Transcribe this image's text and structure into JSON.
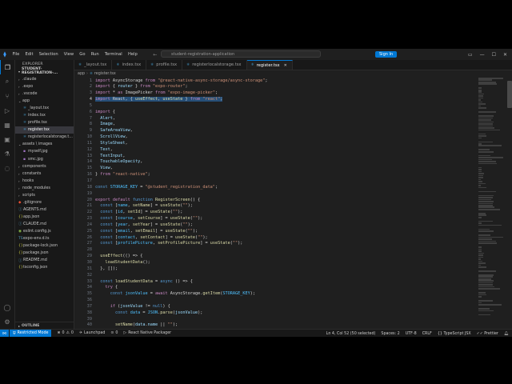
{
  "titlebar": {
    "menu": [
      "File",
      "Edit",
      "Selection",
      "View",
      "Go",
      "Run",
      "Terminal",
      "Help"
    ],
    "back_icon": "arrow-left-icon",
    "forward_icon": "arrow-right-icon",
    "command_center": "student-registration-application",
    "sign_in": "Sign In"
  },
  "activity_bar": {
    "top": [
      "files-icon",
      "search-icon",
      "source-control-icon",
      "run-debug-icon",
      "extensions-icon",
      "remote-explorer-icon",
      "testing-icon",
      "chat-icon"
    ],
    "bottom": [
      "account-icon",
      "settings-gear-icon"
    ]
  },
  "sidebar": {
    "title": "EXPLORER",
    "project": "STUDENT-REGISTRATION-...",
    "outline": "OUTLINE",
    "tree": [
      {
        "label": ".claude",
        "depth": 0,
        "kind": "folder",
        "color": "#c5c5c5"
      },
      {
        "label": ".expo",
        "depth": 0,
        "kind": "folder",
        "color": "#c5c5c5"
      },
      {
        "label": ".vscode",
        "depth": 0,
        "kind": "folder",
        "color": "#c5c5c5"
      },
      {
        "label": "app",
        "depth": 0,
        "kind": "folder-open",
        "color": "#c5c5c5"
      },
      {
        "label": "_layout.tsx",
        "depth": 1,
        "kind": "tsx",
        "color": "#c5c5c5"
      },
      {
        "label": "index.tsx",
        "depth": 1,
        "kind": "tsx",
        "color": "#c5c5c5"
      },
      {
        "label": "profile.tsx",
        "depth": 1,
        "kind": "tsx",
        "color": "#c5c5c5"
      },
      {
        "label": "register.tsx",
        "depth": 1,
        "kind": "tsx",
        "color": "#ffffff",
        "selected": true
      },
      {
        "label": "registerlocalstorage.t...",
        "depth": 1,
        "kind": "tsx",
        "color": "#c5c5c5"
      },
      {
        "label": "assets \\ images",
        "depth": 0,
        "kind": "folder-open",
        "color": "#c5c5c5"
      },
      {
        "label": "myself.jpg",
        "depth": 1,
        "kind": "img",
        "color": "#c5c5c5"
      },
      {
        "label": "smc.jpg",
        "depth": 1,
        "kind": "img",
        "color": "#c5c5c5"
      },
      {
        "label": "components",
        "depth": 0,
        "kind": "folder",
        "color": "#c5c5c5"
      },
      {
        "label": "constants",
        "depth": 0,
        "kind": "folder",
        "color": "#c5c5c5"
      },
      {
        "label": "hooks",
        "depth": 0,
        "kind": "folder",
        "color": "#c5c5c5"
      },
      {
        "label": "node_modules",
        "depth": 0,
        "kind": "folder",
        "color": "#c5c5c5"
      },
      {
        "label": "scripts",
        "depth": 0,
        "kind": "folder",
        "color": "#c5c5c5"
      },
      {
        "label": ".gitignore",
        "depth": 0,
        "kind": "git",
        "color": "#c5c5c5"
      },
      {
        "label": "AGENTS.md",
        "depth": 0,
        "kind": "md",
        "color": "#c5c5c5"
      },
      {
        "label": "app.json",
        "depth": 0,
        "kind": "json",
        "color": "#c5c5c5"
      },
      {
        "label": "CLAUDE.md",
        "depth": 0,
        "kind": "md",
        "color": "#c5c5c5"
      },
      {
        "label": "eslint.config.js",
        "depth": 0,
        "kind": "js",
        "color": "#c5c5c5"
      },
      {
        "label": "expo-env.d.ts",
        "depth": 0,
        "kind": "ts",
        "color": "#c5c5c5"
      },
      {
        "label": "package-lock.json",
        "depth": 0,
        "kind": "json",
        "color": "#c5c5c5"
      },
      {
        "label": "package.json",
        "depth": 0,
        "kind": "json",
        "color": "#c5c5c5"
      },
      {
        "label": "README.md",
        "depth": 0,
        "kind": "md",
        "color": "#c5c5c5"
      },
      {
        "label": "tsconfig.json",
        "depth": 0,
        "kind": "json",
        "color": "#c5c5c5"
      }
    ]
  },
  "tabs": [
    {
      "label": "_layout.tsx",
      "active": false
    },
    {
      "label": "index.tsx",
      "active": false
    },
    {
      "label": "profile.tsx",
      "active": false
    },
    {
      "label": "registerlocalstorage.tsx",
      "active": false
    },
    {
      "label": "register.tsx",
      "active": true
    }
  ],
  "breadcrumb": [
    "app",
    "register.tsx"
  ],
  "code": {
    "start_line": 1,
    "lines": [
      [
        [
          "kw",
          "import"
        ],
        [
          "pl",
          " AsyncStorage "
        ],
        [
          "kw",
          "from"
        ],
        [
          "st",
          " \"@react-native-async-storage/async-storage\""
        ],
        [
          "pl",
          ";"
        ]
      ],
      [
        [
          "kw",
          "import"
        ],
        [
          "pl",
          " { "
        ],
        [
          "id",
          "router"
        ],
        [
          "pl",
          " } "
        ],
        [
          "kw",
          "from"
        ],
        [
          "st",
          " \"expo-router\""
        ],
        [
          "pl",
          ";"
        ]
      ],
      [
        [
          "kw",
          "import"
        ],
        [
          "pl",
          " * "
        ],
        [
          "kw",
          "as"
        ],
        [
          "pl",
          " ImagePicker "
        ],
        [
          "kw",
          "from"
        ],
        [
          "st",
          " \"expo-image-picker\""
        ],
        [
          "pl",
          ";"
        ]
      ],
      [
        [
          "kw",
          "import"
        ],
        [
          "pl",
          " React, { "
        ],
        [
          "fn",
          "useEffect"
        ],
        [
          "pl",
          ", "
        ],
        [
          "fn",
          "useState"
        ],
        [
          "pl",
          " } "
        ],
        [
          "kw",
          "from"
        ],
        [
          "st",
          " \"react\""
        ],
        [
          "pl",
          ";"
        ]
      ],
      [],
      [
        [
          "kw",
          "import"
        ],
        [
          "pl",
          " {"
        ]
      ],
      [
        [
          "pl",
          "  "
        ],
        [
          "id",
          "Alert"
        ],
        [
          "pl",
          ","
        ]
      ],
      [
        [
          "pl",
          "  "
        ],
        [
          "id",
          "Image"
        ],
        [
          "pl",
          ","
        ]
      ],
      [
        [
          "pl",
          "  "
        ],
        [
          "id",
          "SafeAreaView"
        ],
        [
          "pl",
          ","
        ]
      ],
      [
        [
          "pl",
          "  "
        ],
        [
          "id",
          "ScrollView"
        ],
        [
          "pl",
          ","
        ]
      ],
      [
        [
          "pl",
          "  "
        ],
        [
          "id",
          "StyleSheet"
        ],
        [
          "pl",
          ","
        ]
      ],
      [
        [
          "pl",
          "  "
        ],
        [
          "id",
          "Text"
        ],
        [
          "pl",
          ","
        ]
      ],
      [
        [
          "pl",
          "  "
        ],
        [
          "id",
          "TextInput"
        ],
        [
          "pl",
          ","
        ]
      ],
      [
        [
          "pl",
          "  "
        ],
        [
          "id",
          "TouchableOpacity"
        ],
        [
          "pl",
          ","
        ]
      ],
      [
        [
          "pl",
          "  "
        ],
        [
          "id",
          "View"
        ],
        [
          "pl",
          ","
        ]
      ],
      [
        [
          "pl",
          "} "
        ],
        [
          "kw",
          "from"
        ],
        [
          "st",
          " \"react-native\""
        ],
        [
          "pl",
          ";"
        ]
      ],
      [],
      [
        [
          "kb",
          "const"
        ],
        [
          "cn",
          " STORAGE_KEY"
        ],
        [
          "pl",
          " = "
        ],
        [
          "st",
          "\"@student_registration_data\""
        ],
        [
          "pl",
          ";"
        ]
      ],
      [],
      [
        [
          "kw",
          "export"
        ],
        [
          "kw",
          " default"
        ],
        [
          "kb",
          " function"
        ],
        [
          "fn",
          " RegisterScreen"
        ],
        [
          "pl",
          "() {"
        ]
      ],
      [
        [
          "pl",
          "  "
        ],
        [
          "kb",
          "const"
        ],
        [
          "pl",
          " ["
        ],
        [
          "cn",
          "name"
        ],
        [
          "pl",
          ", "
        ],
        [
          "fn",
          "setName"
        ],
        [
          "pl",
          "] = "
        ],
        [
          "fn",
          "useState"
        ],
        [
          "pl",
          "("
        ],
        [
          "st",
          "\"\""
        ],
        [
          "pl",
          ");"
        ]
      ],
      [
        [
          "pl",
          "  "
        ],
        [
          "kb",
          "const"
        ],
        [
          "pl",
          " ["
        ],
        [
          "cn",
          "id"
        ],
        [
          "pl",
          ", "
        ],
        [
          "fn",
          "setId"
        ],
        [
          "pl",
          "] = "
        ],
        [
          "fn",
          "useState"
        ],
        [
          "pl",
          "("
        ],
        [
          "st",
          "\"\""
        ],
        [
          "pl",
          ");"
        ]
      ],
      [
        [
          "pl",
          "  "
        ],
        [
          "kb",
          "const"
        ],
        [
          "pl",
          " ["
        ],
        [
          "cn",
          "course"
        ],
        [
          "pl",
          ", "
        ],
        [
          "fn",
          "setCourse"
        ],
        [
          "pl",
          "] = "
        ],
        [
          "fn",
          "useState"
        ],
        [
          "pl",
          "("
        ],
        [
          "st",
          "\"\""
        ],
        [
          "pl",
          ");"
        ]
      ],
      [
        [
          "pl",
          "  "
        ],
        [
          "kb",
          "const"
        ],
        [
          "pl",
          " ["
        ],
        [
          "cn",
          "year"
        ],
        [
          "pl",
          ", "
        ],
        [
          "fn",
          "setYear"
        ],
        [
          "pl",
          "] = "
        ],
        [
          "fn",
          "useState"
        ],
        [
          "pl",
          "("
        ],
        [
          "st",
          "\"\""
        ],
        [
          "pl",
          ");"
        ]
      ],
      [
        [
          "pl",
          "  "
        ],
        [
          "kb",
          "const"
        ],
        [
          "pl",
          " ["
        ],
        [
          "cn",
          "email"
        ],
        [
          "pl",
          ", "
        ],
        [
          "fn",
          "setEmail"
        ],
        [
          "pl",
          "] = "
        ],
        [
          "fn",
          "useState"
        ],
        [
          "pl",
          "("
        ],
        [
          "st",
          "\"\""
        ],
        [
          "pl",
          ");"
        ]
      ],
      [
        [
          "pl",
          "  "
        ],
        [
          "kb",
          "const"
        ],
        [
          "pl",
          " ["
        ],
        [
          "cn",
          "contact"
        ],
        [
          "pl",
          ", "
        ],
        [
          "fn",
          "setContact"
        ],
        [
          "pl",
          "] = "
        ],
        [
          "fn",
          "useState"
        ],
        [
          "pl",
          "("
        ],
        [
          "st",
          "\"\""
        ],
        [
          "pl",
          ");"
        ]
      ],
      [
        [
          "pl",
          "  "
        ],
        [
          "kb",
          "const"
        ],
        [
          "pl",
          " ["
        ],
        [
          "cn",
          "profilePicture"
        ],
        [
          "pl",
          ", "
        ],
        [
          "fn",
          "setProfilePicture"
        ],
        [
          "pl",
          "] = "
        ],
        [
          "fn",
          "useState"
        ],
        [
          "pl",
          "("
        ],
        [
          "st",
          "\"\""
        ],
        [
          "pl",
          ");"
        ]
      ],
      [],
      [
        [
          "pl",
          "  "
        ],
        [
          "fn",
          "useEffect"
        ],
        [
          "pl",
          "(() => {"
        ]
      ],
      [
        [
          "pl",
          "    "
        ],
        [
          "fn",
          "loadStudentData"
        ],
        [
          "pl",
          "();"
        ]
      ],
      [
        [
          "pl",
          "  }, []);"
        ]
      ],
      [],
      [
        [
          "pl",
          "  "
        ],
        [
          "kb",
          "const"
        ],
        [
          "fn",
          " loadStudentData"
        ],
        [
          "pl",
          " = "
        ],
        [
          "kb",
          "async"
        ],
        [
          "pl",
          " () => {"
        ]
      ],
      [
        [
          "pl",
          "    "
        ],
        [
          "kw",
          "try"
        ],
        [
          "pl",
          " {"
        ]
      ],
      [
        [
          "pl",
          "      "
        ],
        [
          "kb",
          "const"
        ],
        [
          "cn",
          " jsonValue"
        ],
        [
          "pl",
          " = "
        ],
        [
          "kw",
          "await"
        ],
        [
          "pl",
          " AsyncStorage."
        ],
        [
          "fn",
          "getItem"
        ],
        [
          "pl",
          "("
        ],
        [
          "cn",
          "STORAGE_KEY"
        ],
        [
          "pl",
          ");"
        ]
      ],
      [],
      [
        [
          "pl",
          "      "
        ],
        [
          "kw",
          "if"
        ],
        [
          "pl",
          " ("
        ],
        [
          "id",
          "jsonValue"
        ],
        [
          "pl",
          " != "
        ],
        [
          "kb",
          "null"
        ],
        [
          "pl",
          ") {"
        ]
      ],
      [
        [
          "pl",
          "        "
        ],
        [
          "kb",
          "const"
        ],
        [
          "cn",
          " data"
        ],
        [
          "pl",
          " = "
        ],
        [
          "cn",
          "JSON"
        ],
        [
          "pl",
          "."
        ],
        [
          "fn",
          "parse"
        ],
        [
          "pl",
          "("
        ],
        [
          "id",
          "jsonValue"
        ],
        [
          "pl",
          ");"
        ]
      ],
      [],
      [
        [
          "pl",
          "        "
        ],
        [
          "fn",
          "setName"
        ],
        [
          "pl",
          "("
        ],
        [
          "id",
          "data"
        ],
        [
          "pl",
          "."
        ],
        [
          "id",
          "name"
        ],
        [
          "pl",
          " || "
        ],
        [
          "st",
          "\"\""
        ],
        [
          "pl",
          ");"
        ]
      ]
    ],
    "highlight_line": 4,
    "line_numbers": [
      "1",
      "2",
      "3",
      "4",
      "5",
      "6",
      "7",
      "8",
      "9",
      "10",
      "11",
      "12",
      "13",
      "14",
      "15",
      "16",
      "17",
      "18",
      "19",
      "20",
      "21",
      "22",
      "23",
      "24",
      "25",
      "26",
      "27",
      "28",
      "29",
      "30",
      "31",
      "32",
      "33",
      "34",
      "35",
      "36",
      "37",
      "38",
      "39",
      "40"
    ]
  },
  "statusbar": {
    "restricted": "Restricted Mode",
    "errors": "0",
    "warnings": "0",
    "launchpad": "Launchpad",
    "ports": "0",
    "packager": "React Native Packager",
    "position": "Ln 4, Col 52 (50 selected)",
    "spaces": "Spaces: 2",
    "encoding": "UTF-8",
    "eol": "CRLF",
    "language": "TypeScript JSX",
    "prettier": "Prettier"
  }
}
